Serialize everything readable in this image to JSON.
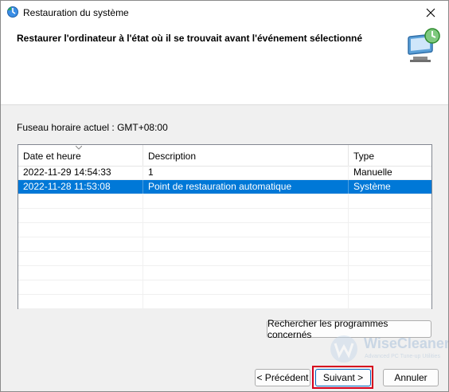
{
  "window": {
    "title": "Restauration du système",
    "header_title": "Restaurer l'ordinateur à l'état où il se trouvait avant l'événement sélectionné"
  },
  "timezone_label": "Fuseau horaire actuel : GMT+08:00",
  "table": {
    "columns": [
      "Date et heure",
      "Description",
      "Type"
    ],
    "rows": [
      {
        "date": "2022-11-29 14:54:33",
        "description": "1",
        "type": "Manuelle",
        "selected": false
      },
      {
        "date": "2022-11-28 11:53:08",
        "description": "Point de restauration automatique",
        "type": "Système",
        "selected": true
      }
    ]
  },
  "buttons": {
    "search": "Rechercher les programmes concernés",
    "previous": "< Précédent",
    "next": "Suivant >",
    "cancel": "Annuler"
  },
  "watermark": {
    "name": "WiseCleaner",
    "subtitle": "Advanced PC Tune-up Utilities"
  },
  "colors": {
    "selection": "#0078d7",
    "highlight_box": "#d6001c"
  }
}
